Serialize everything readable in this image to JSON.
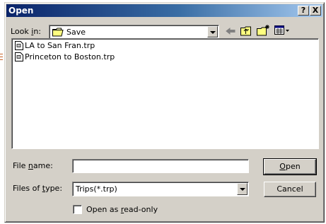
{
  "window": {
    "title": "Open",
    "help_button": "?",
    "close_button": "X"
  },
  "look_in": {
    "label_pre": "Look ",
    "label_key": "i",
    "label_post": "n:",
    "value": "Save"
  },
  "toolbar": [
    "back-icon",
    "up-folder-icon",
    "new-folder-icon",
    "view-menu-icon"
  ],
  "files": [
    {
      "name": "LA to San Fran.trp",
      "icon": "trip-file-icon"
    },
    {
      "name": "Princeton to Boston.trp",
      "icon": "trip-file-icon"
    }
  ],
  "file_name": {
    "label_pre": "File ",
    "label_key": "n",
    "label_post": "ame:",
    "value": ""
  },
  "file_type": {
    "label_pre": "Files of ",
    "label_key": "t",
    "label_post": "ype:",
    "value": "Trips(*.trp)"
  },
  "buttons": {
    "open_key": "O",
    "open_rest": "pen",
    "cancel": "Cancel"
  },
  "read_only": {
    "label_pre": "Open as ",
    "label_key": "r",
    "label_post": "ead-only",
    "checked": false
  },
  "colors": {
    "title_start": "#0a246a",
    "title_end": "#a6caf0",
    "face": "#d4d0c8"
  }
}
